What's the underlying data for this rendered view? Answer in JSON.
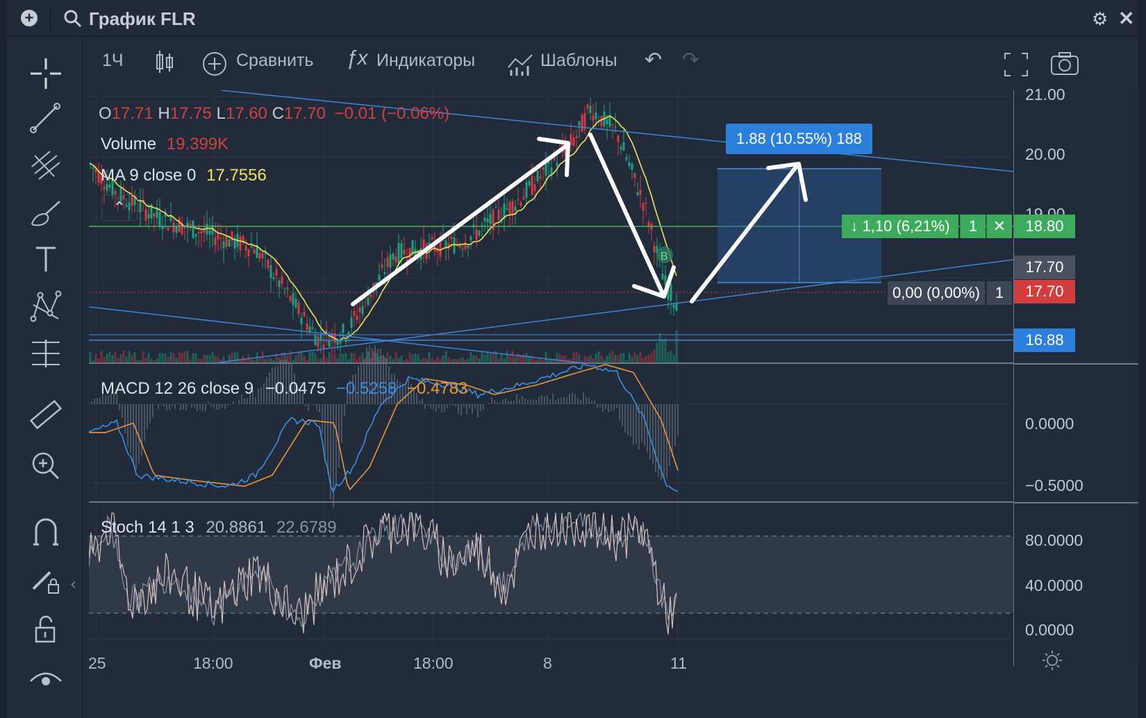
{
  "title": "График FLR",
  "toolbar": {
    "interval": "1Ч",
    "compare": "Сравнить",
    "indicators": "Индикаторы",
    "templates": "Шаблоны"
  },
  "legend": {
    "o_label": "O",
    "o": "17.71",
    "h_label": "H",
    "h": "17.75",
    "l_label": "L",
    "l": "17.60",
    "c_label": "C",
    "c": "17.70",
    "change": "−0.01 (−0.06%)",
    "volume_label": "Volume",
    "volume": "19.399K",
    "ma_label": "MA 9 close 0",
    "ma": "17.7556",
    "macd_label": "MACD 12 26 close 9",
    "macd_hist": "−0.0475",
    "macd_line": "−0.5258",
    "macd_signal": "−0.4783",
    "stoch_label": "Stoch 14 1 3",
    "stoch_k": "20.8861",
    "stoch_d": "22.6789"
  },
  "price_axis": {
    "ticks": [
      "21.00",
      "20.00",
      "19.00"
    ],
    "level_tags": {
      "green": "18.80",
      "grey": "17.70",
      "red": "17.70",
      "blue": "16.88"
    },
    "macd_ticks": [
      "0.0000",
      "−0.5000"
    ],
    "stoch_ticks": [
      "80.0000",
      "40.0000",
      "0.0000"
    ]
  },
  "time_axis": [
    "25",
    "18:00",
    "Фев",
    "18:00",
    "8",
    "11"
  ],
  "position_box": {
    "label": "1.88 (10.55%) 188"
  },
  "order_line": {
    "label": "↓ 1,10 (6,21%)",
    "qty": "1",
    "close": "✕"
  },
  "position_line": {
    "label": "0,00 (0,00%)",
    "qty": "1"
  },
  "trade_marker": "B",
  "colors": {
    "background": "#222b3a",
    "up": "#1aa37a",
    "down": "#d73a42",
    "ma": "#f2e25c",
    "macd": "#3d8fe0",
    "signal": "#e8973a",
    "green_tag": "#3cab5c",
    "blue_tag": "#2d7fdc",
    "red_tag": "#d43d3d"
  },
  "icons": {
    "left_tools": [
      "crosshair-icon",
      "trend-line-icon",
      "fib-icon",
      "brush-icon",
      "text-icon",
      "pattern-icon",
      "measure-icon",
      "ruler-icon",
      "zoom-icon",
      "magnet-icon",
      "lock-draw-icon",
      "unlock-icon",
      "eye-icon"
    ]
  },
  "chart_data": {
    "type": "candlestick",
    "price_range": [
      16.6,
      21.1
    ],
    "macd_range": [
      -0.62,
      0.25
    ],
    "stoch_range": [
      0,
      100
    ],
    "annotations": [
      "trend up arrow",
      "trend down arrow",
      "projected up arrow"
    ]
  }
}
